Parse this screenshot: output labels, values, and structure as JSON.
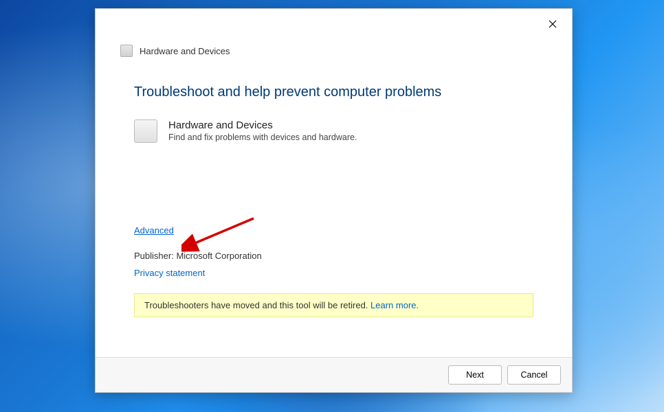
{
  "header": {
    "title": "Hardware and Devices"
  },
  "main": {
    "heading": "Troubleshoot and help prevent computer problems",
    "item": {
      "title": "Hardware and Devices",
      "description": "Find and fix problems with devices and hardware."
    },
    "advanced_link": "Advanced",
    "publisher_label": "Publisher:",
    "publisher_value": "Microsoft Corporation",
    "privacy_link": "Privacy statement",
    "banner_text": "Troubleshooters have moved and this tool will be retired. ",
    "banner_link": "Learn more."
  },
  "footer": {
    "next": "Next",
    "cancel": "Cancel"
  },
  "colors": {
    "accent_link": "#0066cc",
    "heading": "#003a75",
    "banner_bg": "#ffffc8"
  }
}
